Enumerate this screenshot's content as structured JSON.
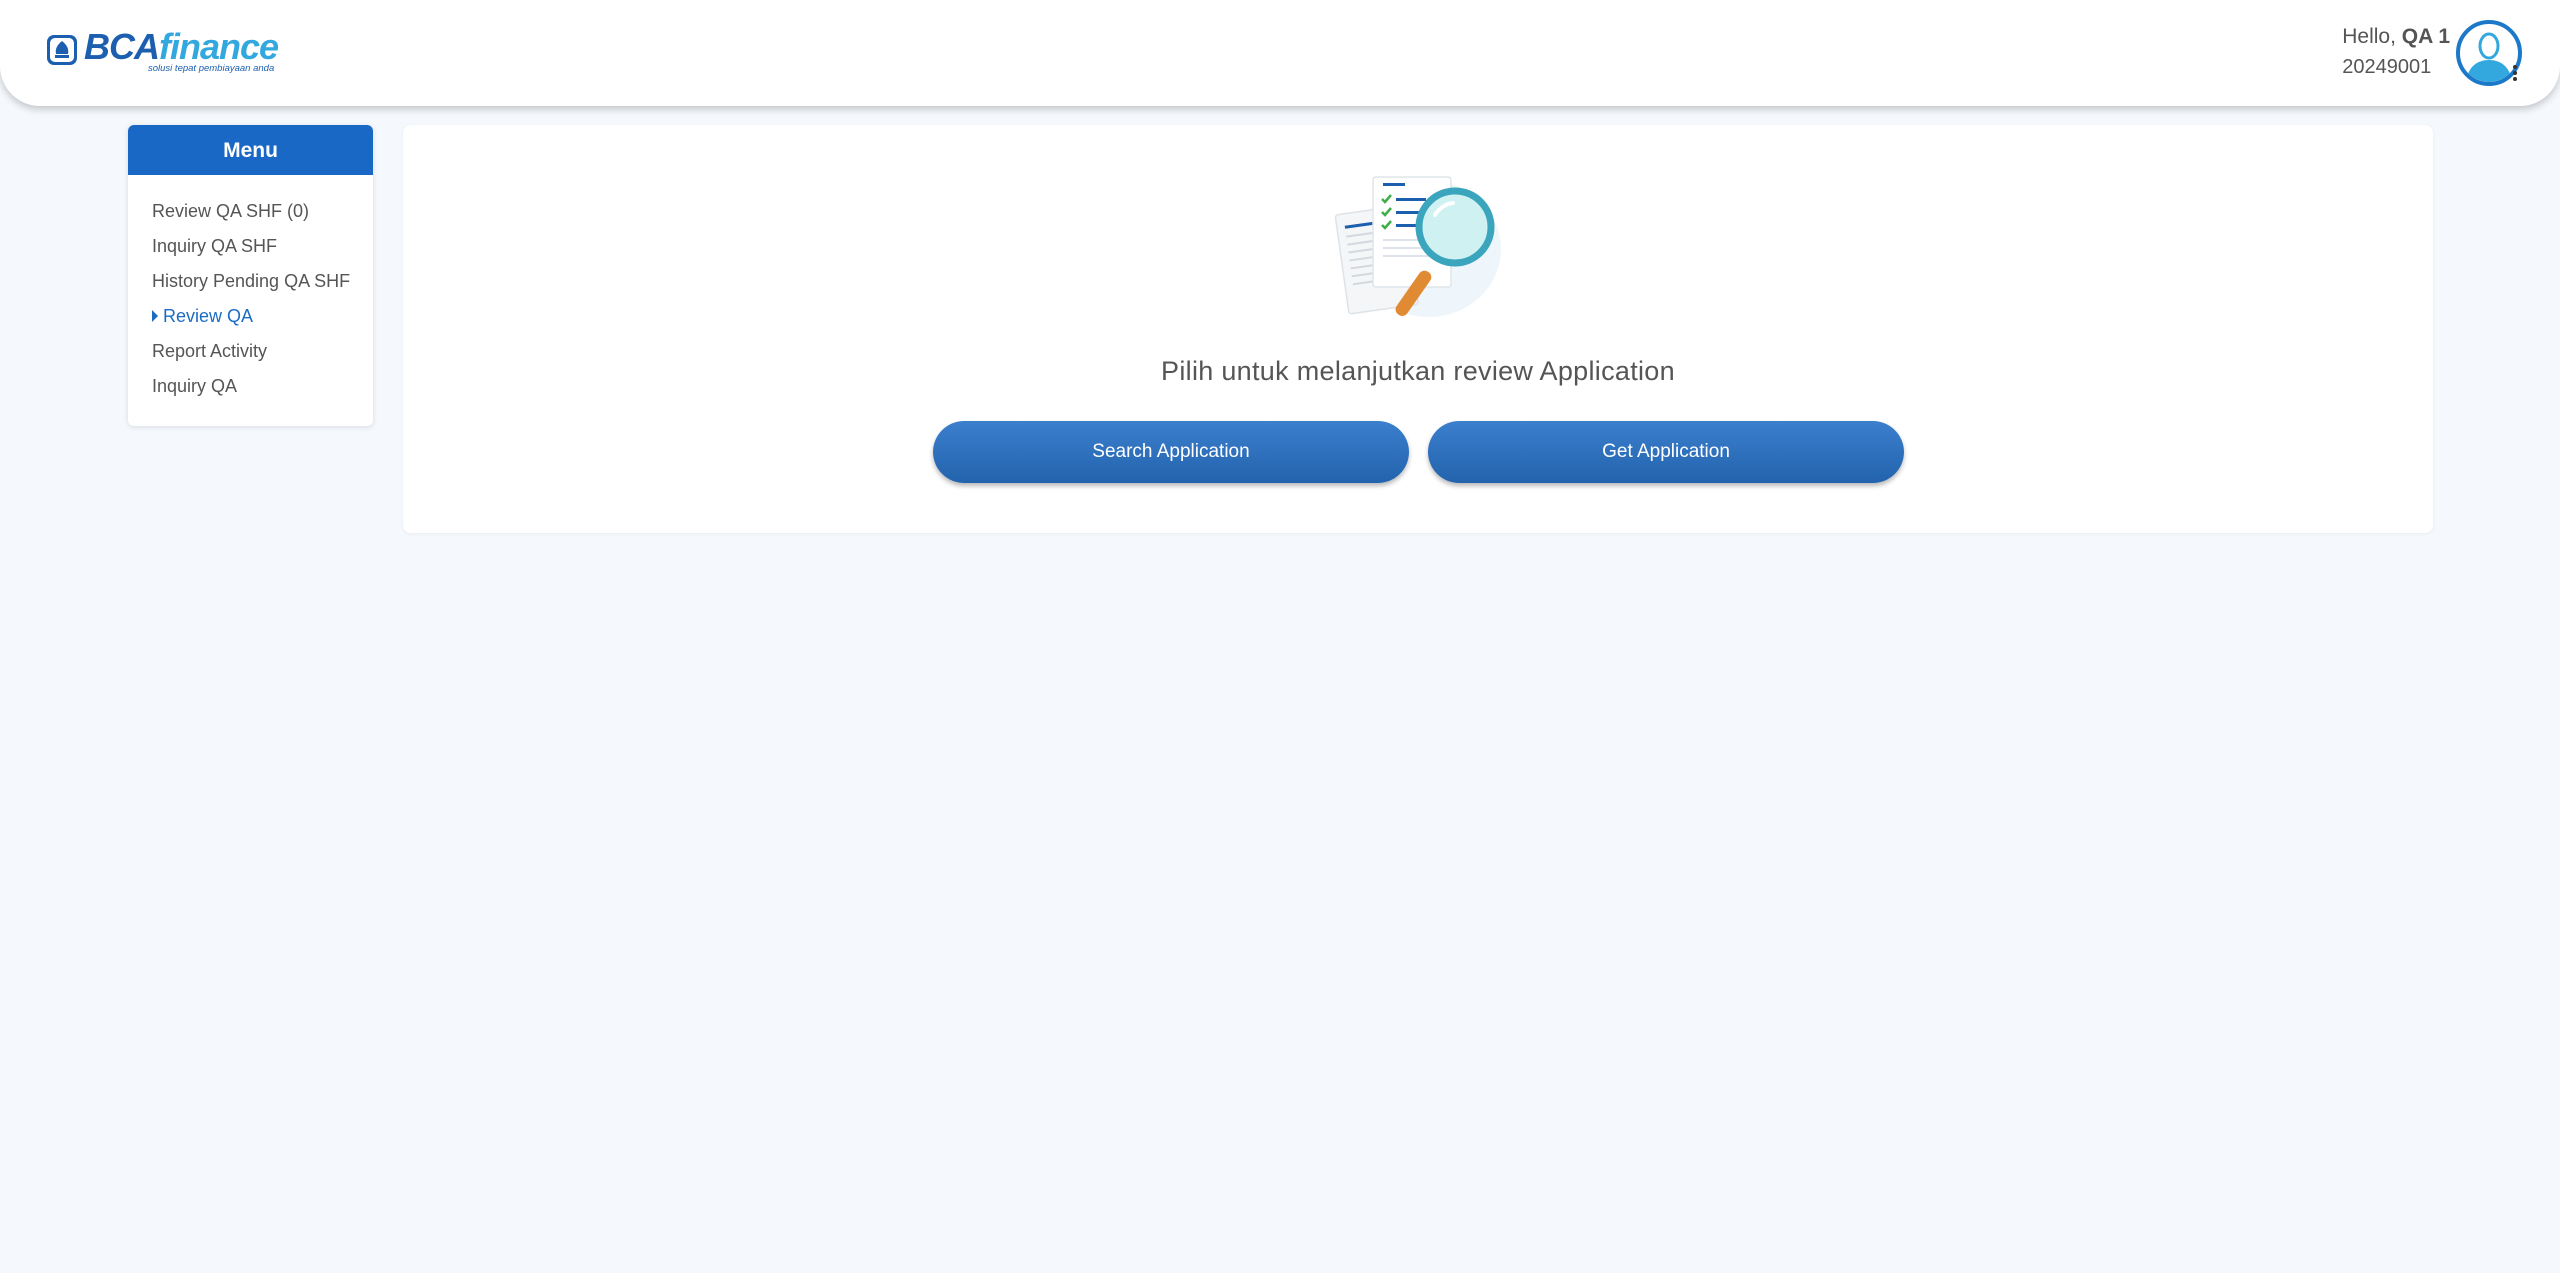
{
  "header": {
    "logo": {
      "brand_part1": "BCA",
      "brand_part2": "finance",
      "tagline": "solusi tepat pembiayaan anda"
    },
    "greeting_prefix": "Hello, ",
    "user_name": "QA 1",
    "user_id": "20249001",
    "avatar_icon": "user-avatar-icon",
    "menu_icon": "kebab-menu-icon"
  },
  "sidebar": {
    "title": "Menu",
    "items": [
      {
        "label": "Review QA SHF (0)",
        "active": false
      },
      {
        "label": "Inquiry QA SHF",
        "active": false
      },
      {
        "label": "History Pending QA SHF",
        "active": false
      },
      {
        "label": "Review QA",
        "active": true
      },
      {
        "label": "Report Activity",
        "active": false
      },
      {
        "label": "Inquiry QA",
        "active": false
      }
    ]
  },
  "main": {
    "illustration_icon": "document-magnifier-icon",
    "prompt": "Pilih untuk melanjutkan review Application",
    "buttons": {
      "search_label": "Search Application",
      "get_label": "Get Application"
    }
  },
  "colors": {
    "primary": "#1a68c6",
    "button_top": "#3b7fcd",
    "button_bottom": "#2363ad",
    "active_menu": "#1c6cc4",
    "page_background": "#f5f9fd"
  }
}
